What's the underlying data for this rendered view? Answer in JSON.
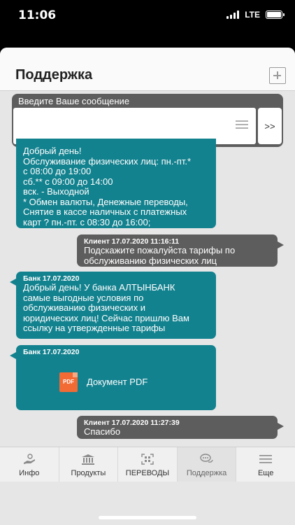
{
  "status_bar": {
    "time": "11:06",
    "network": "LTE"
  },
  "header": {
    "title": "Поддержка"
  },
  "composer": {
    "label": "Введите Ваше сообщение",
    "value": "",
    "send_label": ">>"
  },
  "messages": [
    {
      "from": "bank",
      "meta": "",
      "text": "Добрый день!\nОбслуживание физических лиц:  пн.-пт.*\nс 08:00 до 19:00\nсб.**  с 09:00 до 14:00\nвск. - Выходной\n* Обмен валюты, Денежные переводы,\nСнятие в кассе наличных с платежных\nкарт ? пн.-пт. с 08:30 до 16:00;"
    },
    {
      "from": "client",
      "meta": "Клиент 17.07.2020 11:16:11",
      "text": "Подскажите пожалуйста тарифы по\nобслуживанию физических лиц"
    },
    {
      "from": "bank",
      "meta": "Банк 17.07.2020",
      "text": "Добрый день! У банка АЛТЫНБАНК\nсамые выгодные условия по\nобслуживанию физических и\nюридических лиц! Сейчас пришлю Вам\nссылку на утвержденные тарифы"
    },
    {
      "from": "bank",
      "meta": "Банк 17.07.2020",
      "attachment_icon": "PDF",
      "attachment_label": "Документ PDF"
    },
    {
      "from": "client",
      "meta": "Клиент 17.07.2020 11:27:39",
      "text": "Спасибо"
    }
  ],
  "tabs": [
    {
      "label": "Инфо",
      "icon": "info-hand-icon"
    },
    {
      "label": "Продукты",
      "icon": "bank-building-icon"
    },
    {
      "label": "ПЕРЕВОДЫ",
      "icon": "qr-scan-icon"
    },
    {
      "label": "Поддержка",
      "icon": "chat-bubbles-icon",
      "active": true
    },
    {
      "label": "Еще",
      "icon": "hamburger-menu-icon"
    }
  ],
  "colors": {
    "bank_bubble": "#13828f",
    "client_bubble": "#5d5d5d",
    "pdf_icon": "#f26b35"
  }
}
